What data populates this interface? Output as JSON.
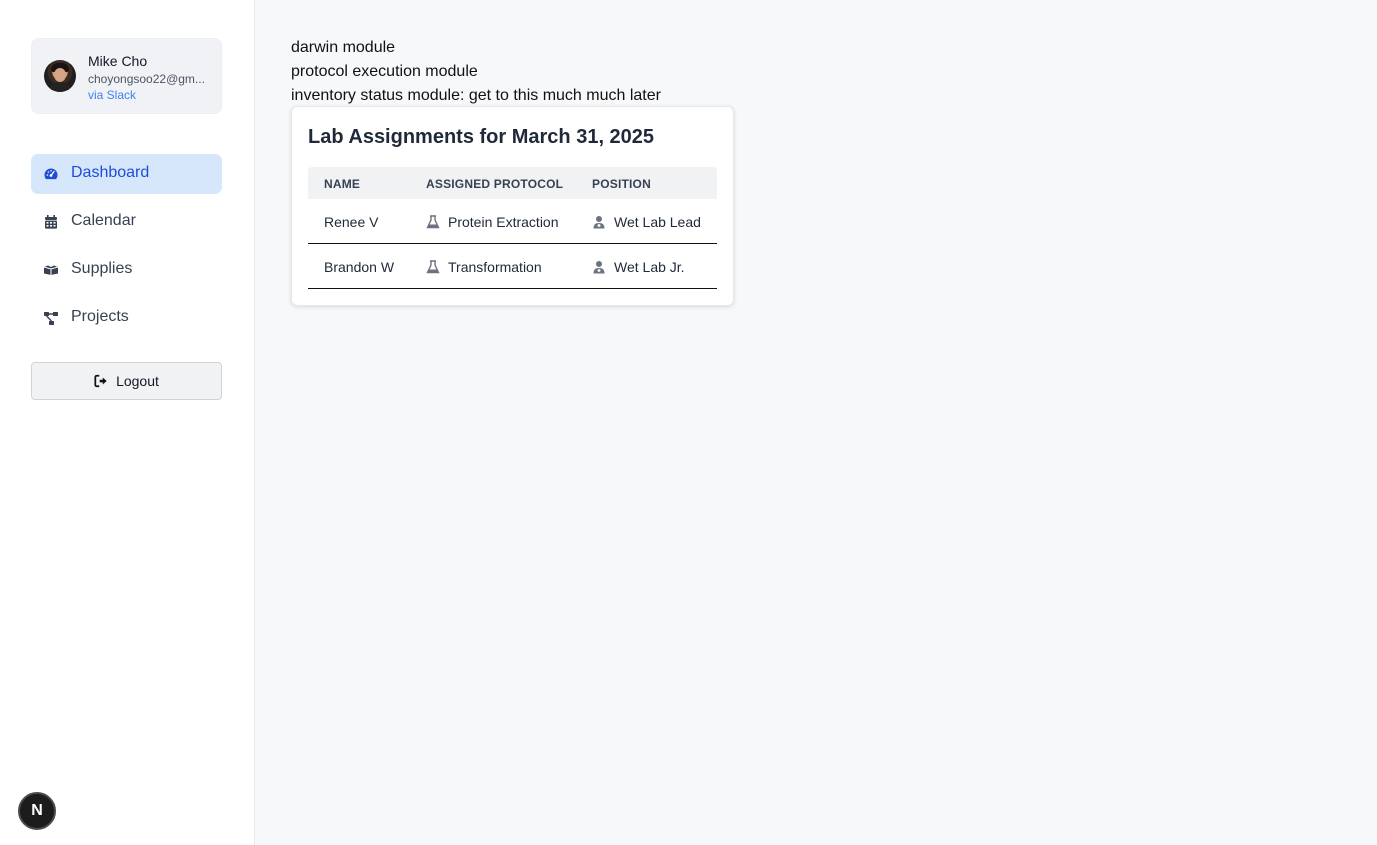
{
  "user": {
    "name": "Mike Cho",
    "email": "choyongsoo22@gm...",
    "via": "via Slack"
  },
  "nav": [
    {
      "label": "Dashboard",
      "icon": "gauge-icon",
      "active": true
    },
    {
      "label": "Calendar",
      "icon": "calendar-icon",
      "active": false
    },
    {
      "label": "Supplies",
      "icon": "boxes-icon",
      "active": false
    },
    {
      "label": "Projects",
      "icon": "diagram-project-icon",
      "active": false
    }
  ],
  "logout_label": "Logout",
  "badge": "N",
  "main_lines": [
    "darwin module",
    "protocol execution module",
    "inventory status module: get to this much much later"
  ],
  "assignments": {
    "title": "Lab Assignments for March 31, 2025",
    "columns": [
      "NAME",
      "ASSIGNED PROTOCOL",
      "POSITION"
    ],
    "rows": [
      {
        "name": "Renee V",
        "protocol": "Protein Extraction",
        "position": "Wet Lab Lead"
      },
      {
        "name": "Brandon W",
        "protocol": "Transformation",
        "position": "Wet Lab Jr."
      }
    ]
  },
  "colors": {
    "accent": "#1d4ed8",
    "active_bg": "#d6e6fb",
    "link": "#3b82f6"
  }
}
